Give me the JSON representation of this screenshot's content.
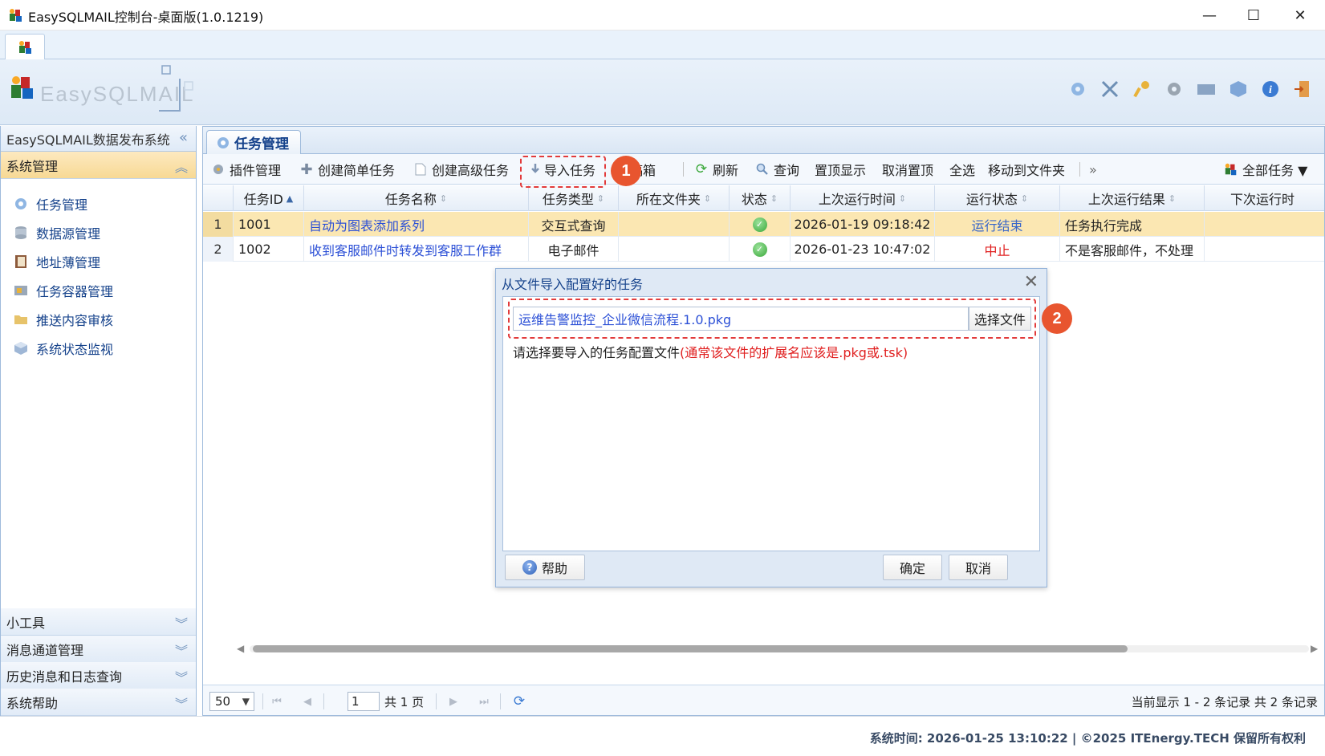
{
  "window": {
    "title": "EasySQLMAIL控制台-桌面版(1.0.1219)",
    "minimize_glyph": "—",
    "maximize_glyph": "☐",
    "close_glyph": "✕"
  },
  "header": {
    "logo_text": "EasySQLMAIL"
  },
  "sidebar": {
    "title": "EasySQLMAIL数据发布系统",
    "collapse_glyph": "«",
    "active_section": "系统管理",
    "items": [
      {
        "label": "任务管理",
        "icon": "gear-icon"
      },
      {
        "label": "数据源管理",
        "icon": "database-icon"
      },
      {
        "label": "地址薄管理",
        "icon": "address-book-icon"
      },
      {
        "label": "任务容器管理",
        "icon": "container-icon"
      },
      {
        "label": "推送内容审核",
        "icon": "folder-icon"
      },
      {
        "label": "系统状态监视",
        "icon": "monitor-icon"
      }
    ],
    "collapsed_sections": [
      "小工具",
      "消息通道管理",
      "历史消息和日志查询",
      "系统帮助"
    ]
  },
  "main": {
    "tab_label": "任务管理",
    "toolbar": {
      "plugin": "插件管理",
      "create_simple": "创建简单任务",
      "create_advanced": "创建高级任务",
      "import": "导入任务",
      "drafts": "稿箱",
      "refresh": "刷新",
      "query": "查询",
      "pin": "置顶显示",
      "unpin": "取消置顶",
      "select_all": "全选",
      "move_to_folder": "移动到文件夹",
      "more": "»",
      "all_tasks": "全部任务 ▼"
    },
    "columns": [
      "任务ID",
      "任务名称",
      "任务类型",
      "所在文件夹",
      "状态",
      "上次运行时间",
      "运行状态",
      "上次运行结果",
      "下次运行时"
    ],
    "rows": [
      {
        "num": "1",
        "id": "1001",
        "name": "自动为图表添加系列",
        "type": "交互式查询",
        "folder": "",
        "last_run": "2026-01-19 09:18:42",
        "run_status": "运行结束",
        "result": "任务执行完成"
      },
      {
        "num": "2",
        "id": "1002",
        "name": "收到客服邮件时转发到客服工作群",
        "type": "电子邮件",
        "folder": "",
        "last_run": "2026-01-23 10:47:02",
        "run_status": "中止",
        "result": "不是客服邮件，不处理"
      }
    ],
    "pager": {
      "page_size": "50",
      "page": "1",
      "total_pages": "共 1 页",
      "summary": "当前显示 1 - 2 条记录 共 2 条记录"
    }
  },
  "modal": {
    "title": "从文件导入配置好的任务",
    "file_value": "运维告警监控_企业微信流程.1.0.pkg",
    "choose_file": "选择文件",
    "hint": "请选择要导入的任务配置文件",
    "hint_warn": "(通常该文件的扩展名应该是.pkg或.tsk)",
    "help": "帮助",
    "ok": "确定",
    "cancel": "取消"
  },
  "callouts": [
    "1",
    "2"
  ],
  "footer": {
    "text": "系统时间:  2026-01-25 13:10:22   |   ©2025 ITEnergy.TECH 保留所有权利"
  },
  "colors": {
    "accent": "#15428b",
    "selected_row": "#fbe7b2",
    "callout": "#e8552f",
    "error": "#e02020"
  }
}
